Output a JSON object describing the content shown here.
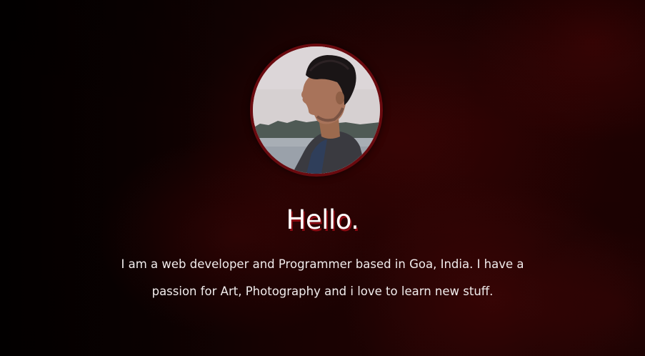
{
  "hero": {
    "greeting": "Hello.",
    "bio_lines": [
      "I am a web developer and Programmer based in Goa, India. I have a",
      "passion for Art, Photography and i love to learn new stuff."
    ],
    "avatar_alt": "profile photo"
  },
  "colors": {
    "background": "#1c0202",
    "accent": "#8b0a12",
    "avatar_ring": "#6a0a0f",
    "text": "#ffffff"
  }
}
